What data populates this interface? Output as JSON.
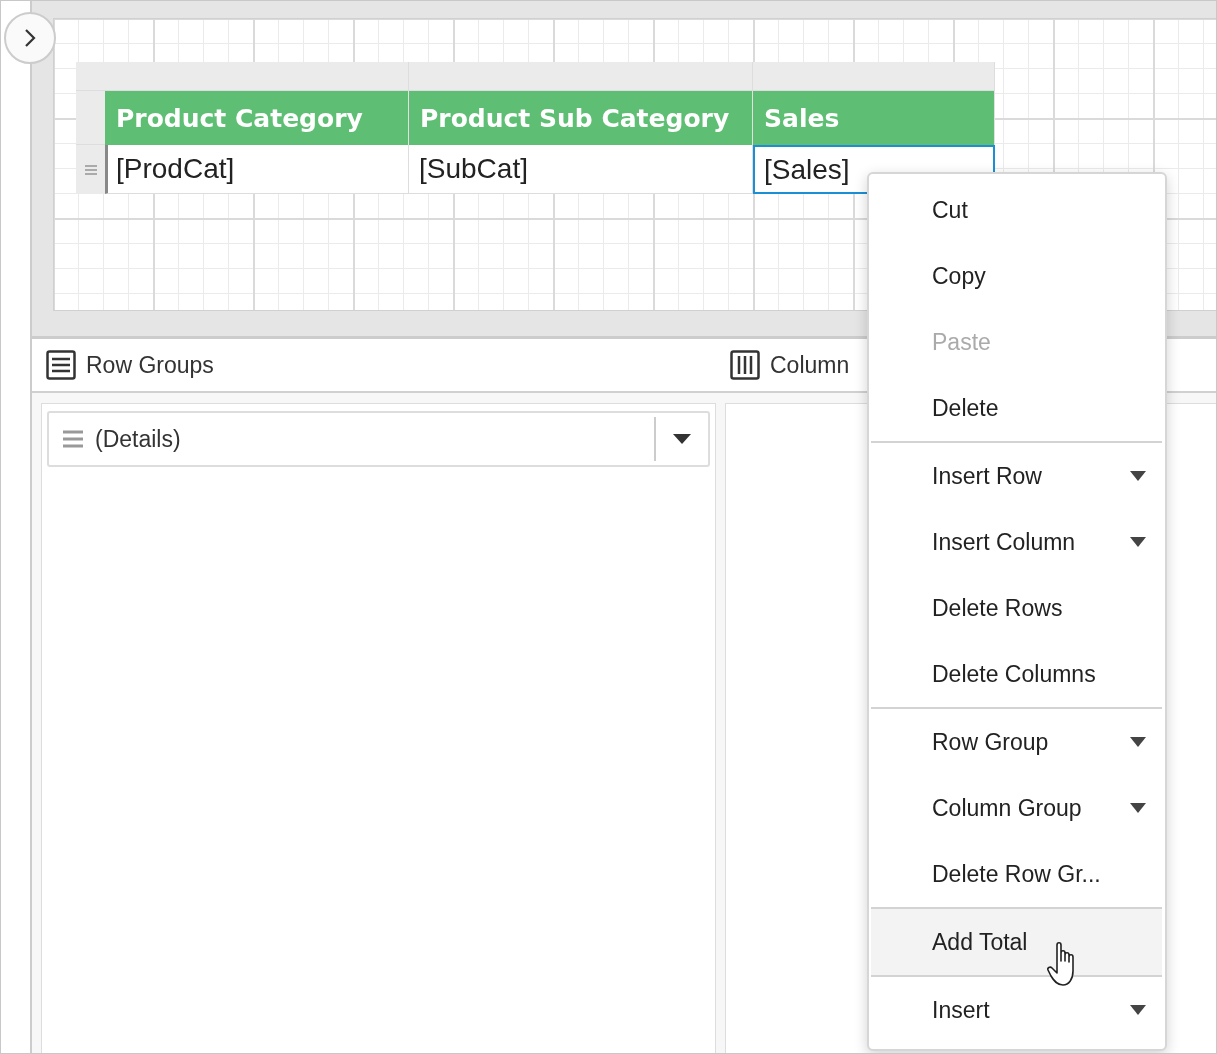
{
  "table": {
    "columns": [
      {
        "header": "Product Category",
        "field": "[ProdCat]",
        "selected": false
      },
      {
        "header": "Product Sub Category",
        "field": "[SubCat]",
        "selected": false
      },
      {
        "header": "Sales",
        "field": "[Sales]",
        "selected": true
      }
    ]
  },
  "group_panels": [
    {
      "kind": "rows",
      "title": "Row Groups",
      "groups": [
        {
          "label": "(Details)"
        }
      ]
    },
    {
      "kind": "columns",
      "title": "Column"
    }
  ],
  "context_menu": [
    {
      "kind": "item",
      "label": "Cut",
      "disabled": false,
      "submenu": false,
      "highlighted": false
    },
    {
      "kind": "item",
      "label": "Copy",
      "disabled": false,
      "submenu": false,
      "highlighted": false
    },
    {
      "kind": "item",
      "label": "Paste",
      "disabled": true,
      "submenu": false,
      "highlighted": false
    },
    {
      "kind": "item",
      "label": "Delete",
      "disabled": false,
      "submenu": false,
      "highlighted": false
    },
    {
      "kind": "separator"
    },
    {
      "kind": "item",
      "label": "Insert Row",
      "disabled": false,
      "submenu": true,
      "highlighted": false
    },
    {
      "kind": "item",
      "label": "Insert Column",
      "disabled": false,
      "submenu": true,
      "highlighted": false
    },
    {
      "kind": "item",
      "label": "Delete Rows",
      "disabled": false,
      "submenu": false,
      "highlighted": false
    },
    {
      "kind": "item",
      "label": "Delete Columns",
      "disabled": false,
      "submenu": false,
      "highlighted": false
    },
    {
      "kind": "separator"
    },
    {
      "kind": "item",
      "label": "Row Group",
      "disabled": false,
      "submenu": true,
      "highlighted": false
    },
    {
      "kind": "item",
      "label": "Column Group",
      "disabled": false,
      "submenu": true,
      "highlighted": false
    },
    {
      "kind": "item",
      "label": "Delete Row Gr...",
      "disabled": false,
      "submenu": false,
      "highlighted": false
    },
    {
      "kind": "separator"
    },
    {
      "kind": "item",
      "label": "Add Total",
      "disabled": false,
      "submenu": false,
      "highlighted": true
    },
    {
      "kind": "separator"
    },
    {
      "kind": "item",
      "label": "Insert",
      "disabled": false,
      "submenu": true,
      "highlighted": false
    }
  ]
}
